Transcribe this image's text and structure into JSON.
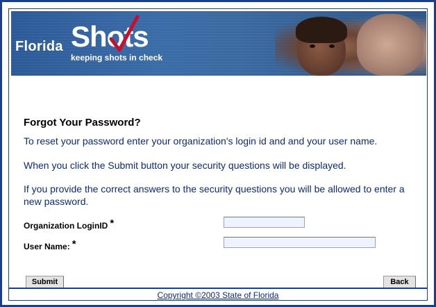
{
  "banner": {
    "brand_word": "Florida",
    "brand_shots": "Shots",
    "tagline": "keeping shots in check"
  },
  "form": {
    "title": "Forgot Your Password?",
    "paragraphs": [
      "To reset your password enter your organization's login id and and your user name.",
      "When you click the Submit button your security questions will be displayed.",
      "If you provide the correct answers to the security questions you will be allowed to enter a new password."
    ],
    "org_label": "Organization LoginID",
    "org_value": "",
    "user_label": "User Name:",
    "user_value": "",
    "required_mark": "*",
    "submit_label": "Submit",
    "back_label": "Back"
  },
  "footer": {
    "copyright": "Copyright ©2003 State of Florida"
  },
  "colors": {
    "border": "#1a3d8f",
    "text_blue": "#0d2a7a",
    "input_bg": "#eef3ff"
  }
}
